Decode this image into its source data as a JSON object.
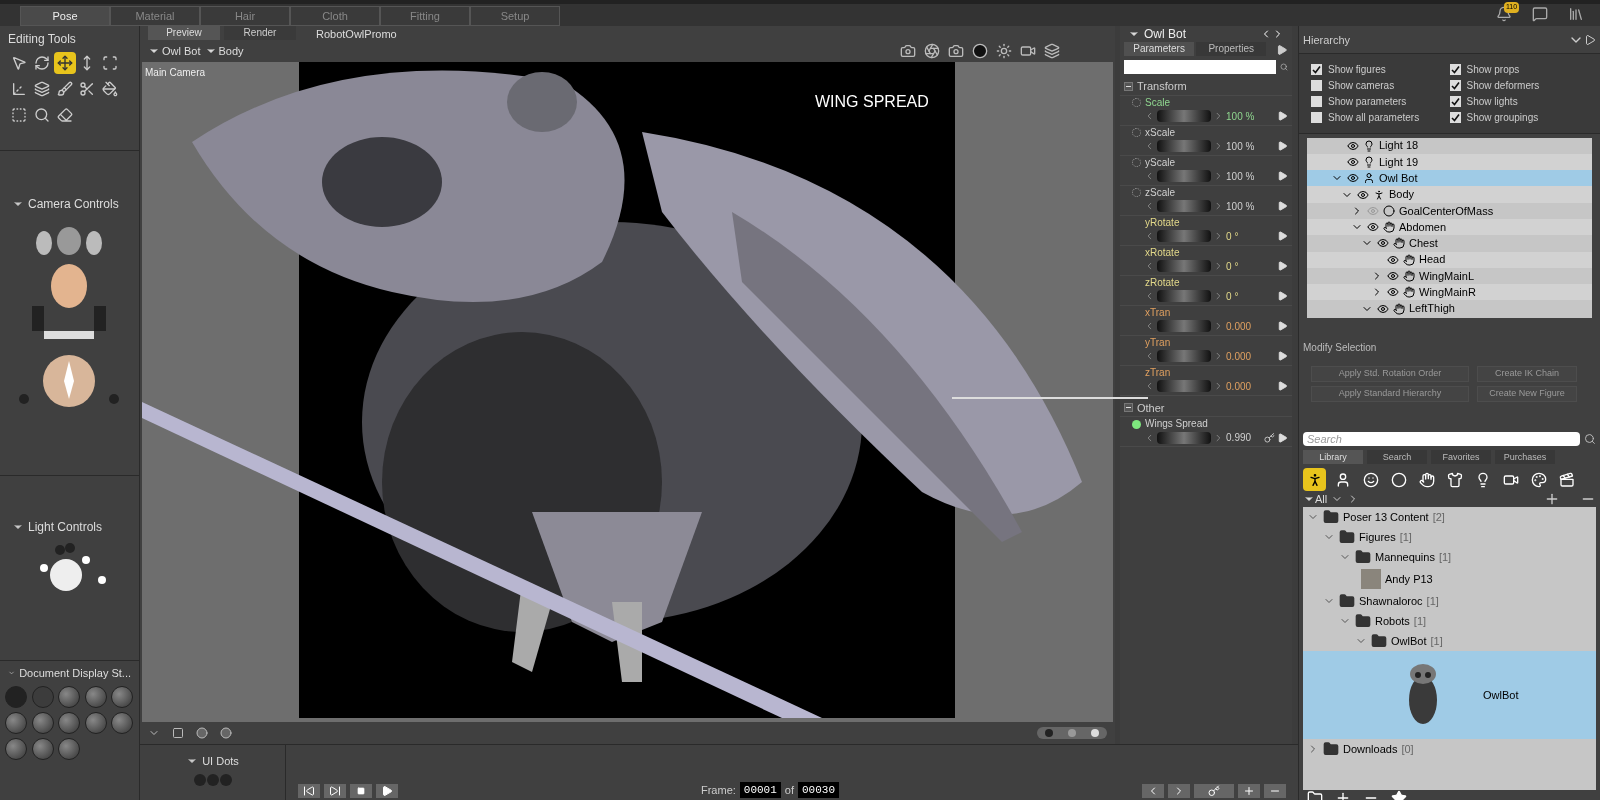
{
  "top_tabs": [
    {
      "label": "Pose",
      "selected": true
    },
    {
      "label": "Material",
      "selected": false
    },
    {
      "label": "Hair",
      "selected": false
    },
    {
      "label": "Cloth",
      "selected": false
    },
    {
      "label": "Fitting",
      "selected": false
    },
    {
      "label": "Setup",
      "selected": false
    }
  ],
  "notification_badge": "110",
  "editing_tools": {
    "title": "Editing Tools",
    "tools": [
      {
        "selected": false
      },
      {
        "selected": false
      },
      {
        "selected": true
      },
      {
        "selected": false
      },
      {
        "selected": false
      },
      {
        "selected": false
      },
      {
        "selected": false
      },
      {
        "selected": false
      },
      {
        "selected": false
      },
      {
        "selected": false
      },
      {
        "selected": false
      },
      {
        "selected": false
      },
      {
        "selected": false
      }
    ]
  },
  "camera_controls": {
    "title": "Camera Controls"
  },
  "light_controls": {
    "title": "Light Controls"
  },
  "document_display": {
    "title": "Document Display St..."
  },
  "ui_dots": {
    "title": "UI Dots"
  },
  "viewport": {
    "tabs": [
      {
        "label": "Preview",
        "selected": true
      },
      {
        "label": "Render",
        "selected": false
      }
    ],
    "document": "RobotOwlPromo",
    "figure": "Owl Bot",
    "actor": "Body",
    "camera": "Main Camera",
    "caption": "WING SPREAD"
  },
  "timeline": {
    "frame_label": "Frame:",
    "current": "00001",
    "of": "of",
    "total": "00030"
  },
  "parameters": {
    "title": "Owl Bot",
    "tabs": [
      {
        "label": "Parameters",
        "selected": true
      },
      {
        "label": "Properties",
        "selected": false
      }
    ],
    "groups": [
      {
        "name": "Transform",
        "expanded": true,
        "params": [
          {
            "name": "Scale",
            "value": "100 %",
            "kind": "scale_master"
          },
          {
            "name": "xScale",
            "value": "100 %",
            "kind": "scale"
          },
          {
            "name": "yScale",
            "value": "100 %",
            "kind": "scale"
          },
          {
            "name": "zScale",
            "value": "100 %",
            "kind": "scale"
          },
          {
            "name": "yRotate",
            "value": "0 °",
            "kind": "rotate"
          },
          {
            "name": "xRotate",
            "value": "0 °",
            "kind": "rotate"
          },
          {
            "name": "zRotate",
            "value": "0 °",
            "kind": "rotate"
          },
          {
            "name": "xTran",
            "value": "0.000",
            "kind": "tran"
          },
          {
            "name": "yTran",
            "value": "0.000",
            "kind": "tran"
          },
          {
            "name": "zTran",
            "value": "0.000",
            "kind": "tran"
          }
        ]
      },
      {
        "name": "Other",
        "expanded": true,
        "params": [
          {
            "name": "Wings Spread",
            "value": "0.990",
            "kind": "morph"
          }
        ]
      }
    ]
  },
  "hierarchy": {
    "title": "Hierarchy",
    "options": [
      {
        "label": "Show figures",
        "checked": true
      },
      {
        "label": "Show props",
        "checked": true
      },
      {
        "label": "Show cameras",
        "checked": false
      },
      {
        "label": "Show deformers",
        "checked": true
      },
      {
        "label": "Show parameters",
        "checked": false
      },
      {
        "label": "Show lights",
        "checked": true
      },
      {
        "label": "Show all parameters",
        "checked": false
      },
      {
        "label": "Show groupings",
        "checked": true
      }
    ],
    "tree": [
      {
        "name": "Light 18",
        "kind": "light",
        "visible": true,
        "selected": false
      },
      {
        "name": "Light 19",
        "kind": "light",
        "visible": true,
        "selected": false
      },
      {
        "name": "Owl Bot",
        "kind": "figure",
        "visible": true,
        "selected": true,
        "expanded": true,
        "children": [
          {
            "name": "Body",
            "kind": "body",
            "visible": true,
            "selected": false,
            "expanded": true,
            "children": [
              {
                "name": "GoalCenterOfMass",
                "kind": "goal",
                "visible": false,
                "selected": false,
                "expanded": false
              },
              {
                "name": "Abdomen",
                "kind": "part",
                "visible": true,
                "selected": false,
                "expanded": true,
                "children": [
                  {
                    "name": "Chest",
                    "kind": "part",
                    "visible": true,
                    "selected": false,
                    "expanded": true,
                    "children": [
                      {
                        "name": "Head",
                        "kind": "part",
                        "visible": true,
                        "selected": false
                      },
                      {
                        "name": "WingMainL",
                        "kind": "part",
                        "visible": true,
                        "selected": false,
                        "expanded": false
                      },
                      {
                        "name": "WingMainR",
                        "kind": "part",
                        "visible": true,
                        "selected": false,
                        "expanded": false
                      }
                    ]
                  },
                  {
                    "name": "LeftThigh",
                    "kind": "part",
                    "visible": true,
                    "selected": false,
                    "expanded": true
                  }
                ]
              }
            ]
          }
        ]
      }
    ],
    "modify_title": "Modify Selection",
    "modify_buttons": [
      {
        "label": "Apply Std. Rotation Order",
        "disabled": true
      },
      {
        "label": "Create IK Chain",
        "disabled": true
      },
      {
        "label": "Apply Standard Hierarchy",
        "disabled": true
      },
      {
        "label": "Create New Figure",
        "disabled": true
      }
    ]
  },
  "library": {
    "search_placeholder": "Search",
    "tabs": [
      {
        "label": "Library",
        "selected": true
      },
      {
        "label": "Search",
        "selected": false
      },
      {
        "label": "Favorites",
        "selected": false
      },
      {
        "label": "Purchases",
        "selected": false
      }
    ],
    "categories": [
      {
        "selected": true
      },
      {
        "selected": false
      },
      {
        "selected": false
      },
      {
        "selected": false
      },
      {
        "selected": false
      },
      {
        "selected": false
      },
      {
        "selected": false
      },
      {
        "selected": false
      },
      {
        "selected": false
      },
      {
        "selected": false
      }
    ],
    "filter": "All",
    "tree": [
      {
        "kind": "folder",
        "name": "Poser 13 Content",
        "count": "[2]",
        "expanded": true,
        "children": [
          {
            "kind": "folder",
            "name": "Figures",
            "count": "[1]",
            "expanded": true,
            "children": [
              {
                "kind": "folder",
                "name": "Mannequins",
                "count": "[1]",
                "expanded": true,
                "children": [
                  {
                    "kind": "item",
                    "name": "Andy P13",
                    "selected": false
                  }
                ]
              }
            ]
          },
          {
            "kind": "folder",
            "name": "Shawnaloroc",
            "count": "[1]",
            "expanded": true,
            "children": [
              {
                "kind": "folder",
                "name": "Robots",
                "count": "[1]",
                "expanded": true,
                "children": [
                  {
                    "kind": "folder",
                    "name": "OwlBot",
                    "count": "[1]",
                    "expanded": true,
                    "children": [
                      {
                        "kind": "item",
                        "name": "OwlBot",
                        "selected": true
                      }
                    ]
                  }
                ]
              }
            ]
          }
        ]
      },
      {
        "kind": "folder",
        "name": "Downloads",
        "count": "[0]",
        "expanded": false
      }
    ]
  }
}
